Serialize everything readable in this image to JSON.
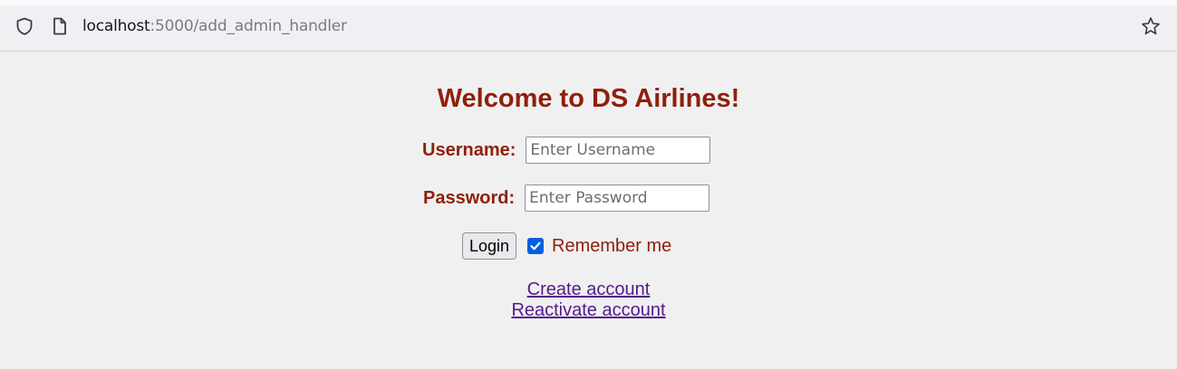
{
  "browser": {
    "url_host": "localhost",
    "url_path": ":5000/add_admin_handler",
    "icons": [
      "shield-icon",
      "page-icon",
      "star-icon"
    ]
  },
  "page": {
    "title": "Welcome to DS Airlines!",
    "username_label": "Username:",
    "username_placeholder": "Enter Username",
    "username_value": "",
    "password_label": "Password:",
    "password_placeholder": "Enter Password",
    "password_value": "",
    "login_label": "Login",
    "remember_label": "Remember me",
    "remember_checked": true,
    "create_account_label": "Create account",
    "reactivate_account_label": "Reactivate account"
  },
  "colors": {
    "accent": "#8f1f0c",
    "link_visited": "#551a8b",
    "checkbox": "#0060df",
    "background": "#f0f0f0"
  }
}
